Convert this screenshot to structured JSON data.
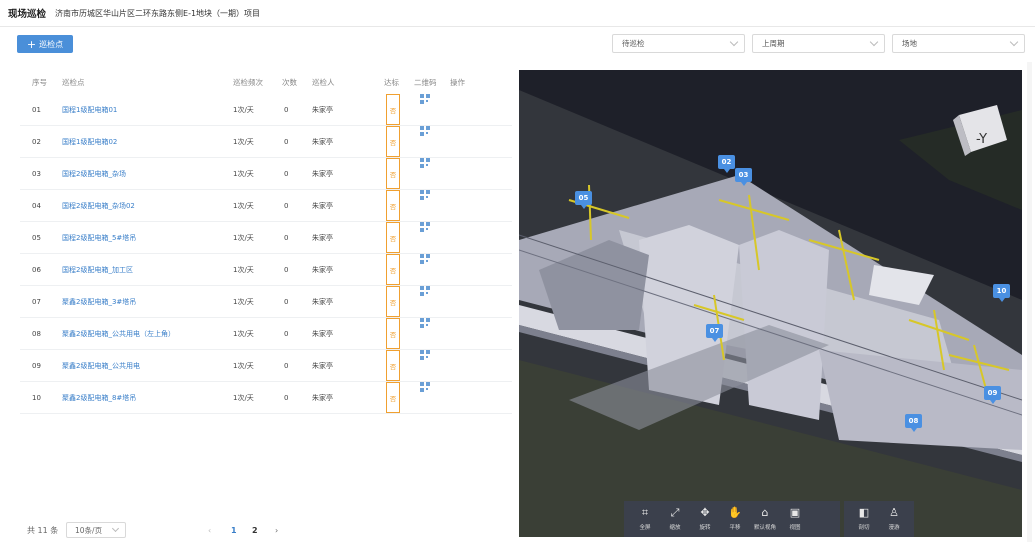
{
  "header": {
    "title": "现场巡检",
    "project": "济南市历城区华山片区二环东路东侧E-1地块（一期）项目"
  },
  "toolbar": {
    "add_label": "巡检点",
    "filters": [
      {
        "value": "待巡检"
      },
      {
        "value": "上周期"
      },
      {
        "value": "场地"
      }
    ]
  },
  "table": {
    "columns": [
      "序号",
      "巡检点",
      "巡检频次",
      "次数",
      "巡检人",
      "达标",
      "二维码",
      "操作"
    ],
    "rows": [
      {
        "no": "01",
        "name": "国程1级配电箱01",
        "freq": "1次/天",
        "count": "0",
        "inspector": "朱家亭",
        "pass": "否"
      },
      {
        "no": "02",
        "name": "国程1级配电箱02",
        "freq": "1次/天",
        "count": "0",
        "inspector": "朱家亭",
        "pass": "否"
      },
      {
        "no": "03",
        "name": "国程2级配电箱_杂场",
        "freq": "1次/天",
        "count": "0",
        "inspector": "朱家亭",
        "pass": "否"
      },
      {
        "no": "04",
        "name": "国程2级配电箱_杂场02",
        "freq": "1次/天",
        "count": "0",
        "inspector": "朱家亭",
        "pass": "否"
      },
      {
        "no": "05",
        "name": "国程2级配电箱_5#塔吊",
        "freq": "1次/天",
        "count": "0",
        "inspector": "朱家亭",
        "pass": "否"
      },
      {
        "no": "06",
        "name": "国程2级配电箱_加工区",
        "freq": "1次/天",
        "count": "0",
        "inspector": "朱家亭",
        "pass": "否"
      },
      {
        "no": "07",
        "name": "聚鑫2级配电箱_3#塔吊",
        "freq": "1次/天",
        "count": "0",
        "inspector": "朱家亭",
        "pass": "否"
      },
      {
        "no": "08",
        "name": "聚鑫2级配电箱_公共用电（左上角）",
        "freq": "1次/天",
        "count": "0",
        "inspector": "朱家亭",
        "pass": "否"
      },
      {
        "no": "09",
        "name": "聚鑫2级配电箱_公共用电",
        "freq": "1次/天",
        "count": "0",
        "inspector": "朱家亭",
        "pass": "否"
      },
      {
        "no": "10",
        "name": "聚鑫2级配电箱_8#塔吊",
        "freq": "1次/天",
        "count": "0",
        "inspector": "朱家亭",
        "pass": "否"
      }
    ]
  },
  "pagination": {
    "total": "共 11 条",
    "page_size": "10条/页",
    "prev": "‹",
    "pages": [
      "1",
      "2"
    ],
    "next": "›",
    "current": "1"
  },
  "viewer": {
    "cube_label": "-Y",
    "markers": [
      "02",
      "03",
      "05",
      "07",
      "08",
      "09",
      "10"
    ],
    "tools_main": [
      {
        "label": "全屏",
        "icon": "fullscreen-icon",
        "glyph": "⌗"
      },
      {
        "label": "缩放",
        "icon": "zoom-icon",
        "glyph": "⤢"
      },
      {
        "label": "旋转",
        "icon": "rotate-icon",
        "glyph": "✥"
      },
      {
        "label": "平移",
        "icon": "pan-hand-icon",
        "glyph": "✋"
      },
      {
        "label": "默认视角",
        "icon": "home-icon",
        "glyph": "⌂"
      },
      {
        "label": "视图",
        "icon": "view-icon",
        "glyph": "▣"
      }
    ],
    "tools_extra": [
      {
        "label": "剖切",
        "icon": "section-icon",
        "glyph": "◧"
      },
      {
        "label": "漫游",
        "icon": "roam-icon",
        "glyph": "♙"
      }
    ]
  },
  "colors": {
    "accent": "#4a8fd9",
    "link": "#3a7fc9",
    "badge": "#f0a030",
    "marker": "#4a90e2",
    "viewer_bg": "#1f222c"
  }
}
